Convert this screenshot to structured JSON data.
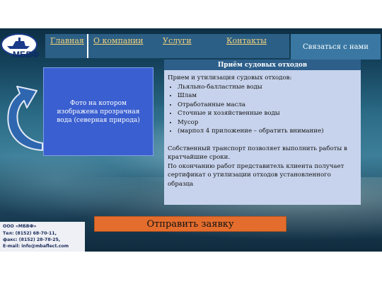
{
  "brand": {
    "logo_text": "МБВФ"
  },
  "nav": {
    "items": [
      {
        "label": "Главная"
      },
      {
        "label": "О компании"
      },
      {
        "label": "Услуги"
      },
      {
        "label": "Контакты"
      }
    ],
    "contact_label": "Связаться  с нами"
  },
  "photo": {
    "caption": "Фото на котором изображена прозрачная вода (северная природа)"
  },
  "panel": {
    "title": "Приём судовых отходов",
    "intro": "Прием и утилизация судовых отходов:",
    "items": [
      "Льяльно-балластные воды",
      "Шлам",
      "Отработанные масла",
      "Сточные и хозяйственные воды",
      "Мусор",
      "(марпол 4 приложение – обратить внимание)"
    ],
    "para1": "Собственный транспорт позволяет выполнить работы в кратчайшие сроки.",
    "para2": "По окончанию работ представитель клиента получает сертификат о утилизации отходов установленного образца"
  },
  "submit_label": "Отправить заявку",
  "footer": {
    "company": "ООО «МБВФ»",
    "tel": "Тел: (8152) 68-70-11,",
    "fax": "факс: (8152) 28-78-25,",
    "email": "E-mail: info@mbaflect.com"
  },
  "colors": {
    "nav": "#2c5f86",
    "nav_text": "#f0d27a",
    "panel_header": "#2d5f8a",
    "panel_body": "#c7d3ec",
    "photo_box": "#3a5fd0",
    "submit": "#e46d2d"
  }
}
